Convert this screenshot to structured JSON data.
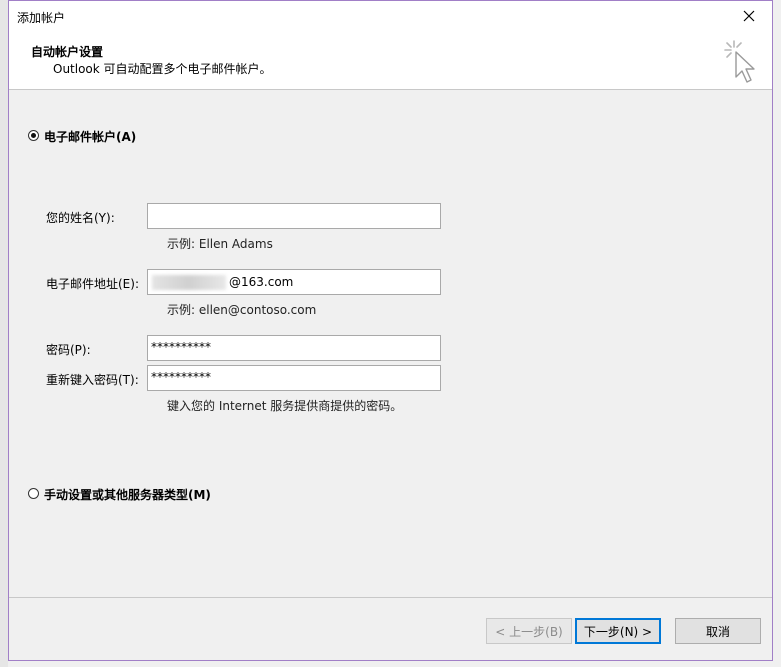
{
  "window": {
    "title": "添加帐户"
  },
  "header": {
    "title": "自动帐户设置",
    "subtitle": "Outlook 可自动配置多个电子邮件帐户。",
    "icon": "cursor-sparkle-icon"
  },
  "options": {
    "email_account": {
      "label": "电子邮件帐户(A)",
      "selected": true
    },
    "manual_setup": {
      "label": "手动设置或其他服务器类型(M)",
      "selected": false
    }
  },
  "form": {
    "name": {
      "label": "您的姓名(Y):",
      "value": "",
      "hint": "示例: Ellen Adams"
    },
    "email": {
      "label": "电子邮件地址(E):",
      "value_visible": "@163.com",
      "hint": "示例: ellen@contoso.com"
    },
    "password": {
      "label": "密码(P):",
      "value": "**********"
    },
    "retype_password": {
      "label": "重新键入密码(T):",
      "value": "**********",
      "hint": "键入您的 Internet 服务提供商提供的密码。"
    }
  },
  "buttons": {
    "back": "< 上一步(B)",
    "next": "下一步(N) >",
    "cancel": "取消"
  },
  "colors": {
    "accent": "#0078d7",
    "window_border": "#a17fc7"
  }
}
